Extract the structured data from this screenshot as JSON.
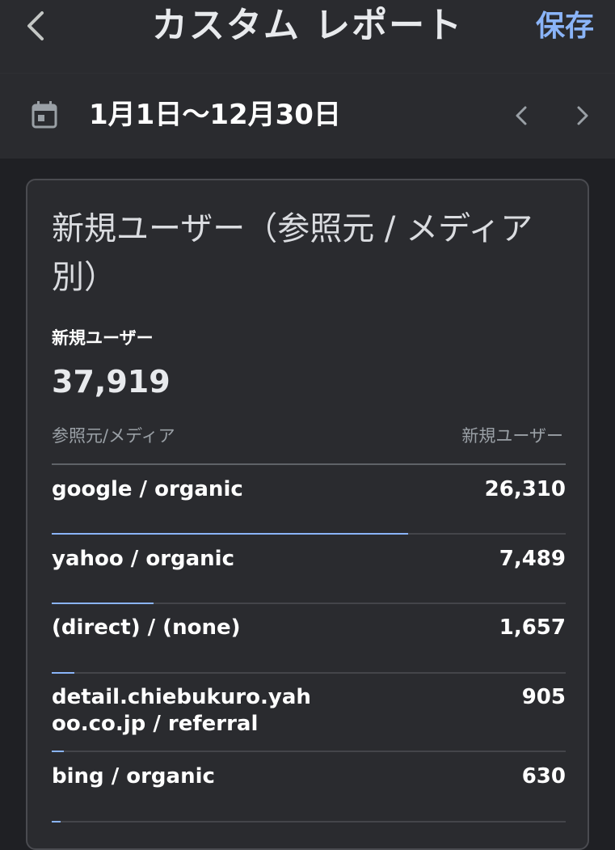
{
  "header": {
    "back_icon": "chevron-left-icon",
    "title": "カスタム レポート",
    "save_label": "保存"
  },
  "date_range": {
    "calendar_icon": "calendar-icon",
    "label": "1月1日〜12月30日",
    "prev_icon": "chevron-left-icon",
    "next_icon": "chevron-right-icon"
  },
  "card": {
    "title": "新規ユーザー（参照元 / メディア別）",
    "metric_label": "新規ユーザー",
    "metric_value": "37,919",
    "column_left": "参照元/メディア",
    "column_right": "新規ユーザー",
    "rows": [
      {
        "name": "google / organic",
        "value": "26,310",
        "share": 0.694
      },
      {
        "name": "yahoo / organic",
        "value": "7,489",
        "share": 0.198
      },
      {
        "name": "(direct) / (none)",
        "value": "1,657",
        "share": 0.044
      },
      {
        "name": "detail.chiebukuro.yahoo.co.jp / referral",
        "value": "905",
        "share": 0.024
      },
      {
        "name": "bing / organic",
        "value": "630",
        "share": 0.017
      }
    ]
  },
  "colors": {
    "background": "#1f2024",
    "surface": "#2a2b2f",
    "accent": "#8ab4f8",
    "text": "#e8eaed",
    "muted": "#9aa0a6"
  }
}
